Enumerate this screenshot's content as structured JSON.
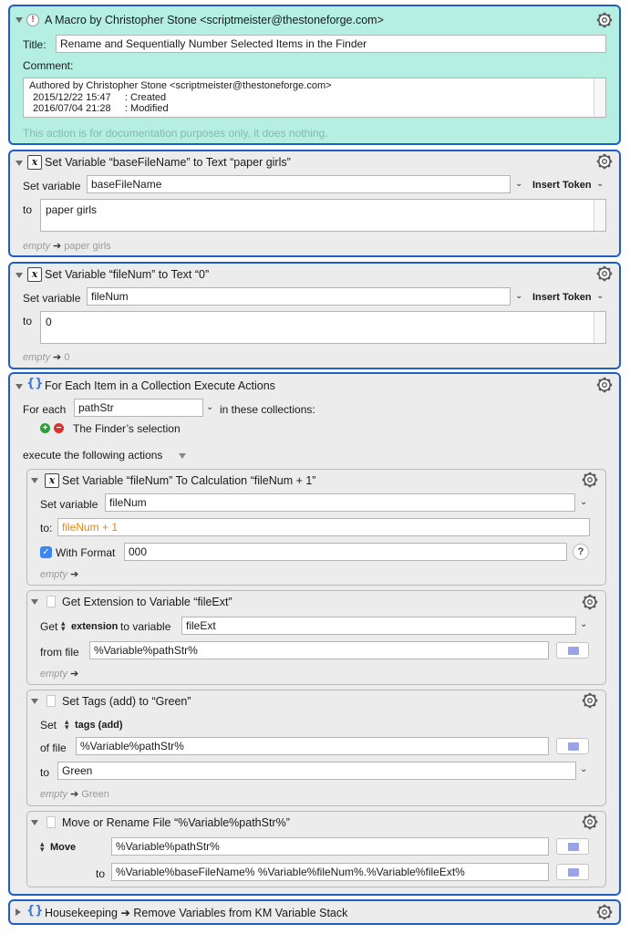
{
  "comment_action": {
    "title": "A Macro by Christopher Stone <scriptmeister@thestoneforge.com>",
    "title_label": "Title:",
    "title_value": "Rename and Sequentially Number Selected Items in the Finder",
    "comment_label": "Comment:",
    "comment_lines": [
      "Authored by Christopher Stone <scriptmeister@thestoneforge.com>",
      "2015/12/22 15:47     : Created",
      "2016/07/04 21:28     : Modified"
    ],
    "note": "This action is for documentation purposes only, it does nothing."
  },
  "set_var_1": {
    "title": "Set Variable “baseFileName” to Text “paper girls”",
    "set_label": "Set variable",
    "variable": "baseFileName",
    "insert_token": "Insert Token",
    "to_label": "to",
    "value": "paper girls",
    "preview_empty": "empty",
    "preview_arrow": "➔",
    "preview_value": "paper girls"
  },
  "set_var_2": {
    "title": "Set Variable “fileNum” to Text “0”",
    "set_label": "Set variable",
    "variable": "fileNum",
    "insert_token": "Insert Token",
    "to_label": "to",
    "value": "0",
    "preview_empty": "empty",
    "preview_arrow": "➔",
    "preview_value": "0"
  },
  "for_each": {
    "title": "For Each Item in a Collection Execute Actions",
    "for_each_label": "For each",
    "variable": "pathStr",
    "collections_label": "in these collections:",
    "collection": "The Finder’s selection",
    "execute_label": "execute the following actions",
    "calc": {
      "title": "Set Variable “fileNum” To Calculation “fileNum + 1”",
      "set_label": "Set variable",
      "variable": "fileNum",
      "to_label": "to:",
      "value": "fileNum + 1",
      "with_format_label": "With Format",
      "format": "000",
      "help": "?",
      "preview_empty": "empty",
      "preview_arrow": "➔"
    },
    "get_ext": {
      "title": "Get Extension to Variable “fileExt”",
      "get_label": "Get",
      "kind": "extension",
      "to_variable_label": "to variable",
      "variable": "fileExt",
      "from_file_label": "from file",
      "file": "%Variable%pathStr%",
      "preview_empty": "empty",
      "preview_arrow": "➔"
    },
    "set_tags": {
      "title": "Set Tags (add) to “Green”",
      "set_label": "Set",
      "mode": "tags (add)",
      "of_file_label": "of file",
      "file": "%Variable%pathStr%",
      "to_label": "to",
      "tag": "Green",
      "preview_empty": "empty",
      "preview_arrow": "➔",
      "preview_value": "Green"
    },
    "move": {
      "title": "Move or Rename File “%Variable%pathStr%”",
      "mode": "Move",
      "source": "%Variable%pathStr%",
      "to_label": "to",
      "destination": "%Variable%baseFileName% %Variable%fileNum%.%Variable%fileExt%"
    }
  },
  "housekeeping": {
    "title": "Housekeeping ➔ Remove Variables from KM Variable Stack"
  },
  "colors": {
    "selection_border": "#1f5fc4",
    "comment_bg": "#b4efe2",
    "action_bg": "#ececec",
    "token_orange": "#e8890c",
    "preview_gray": "#9a9a9a"
  }
}
